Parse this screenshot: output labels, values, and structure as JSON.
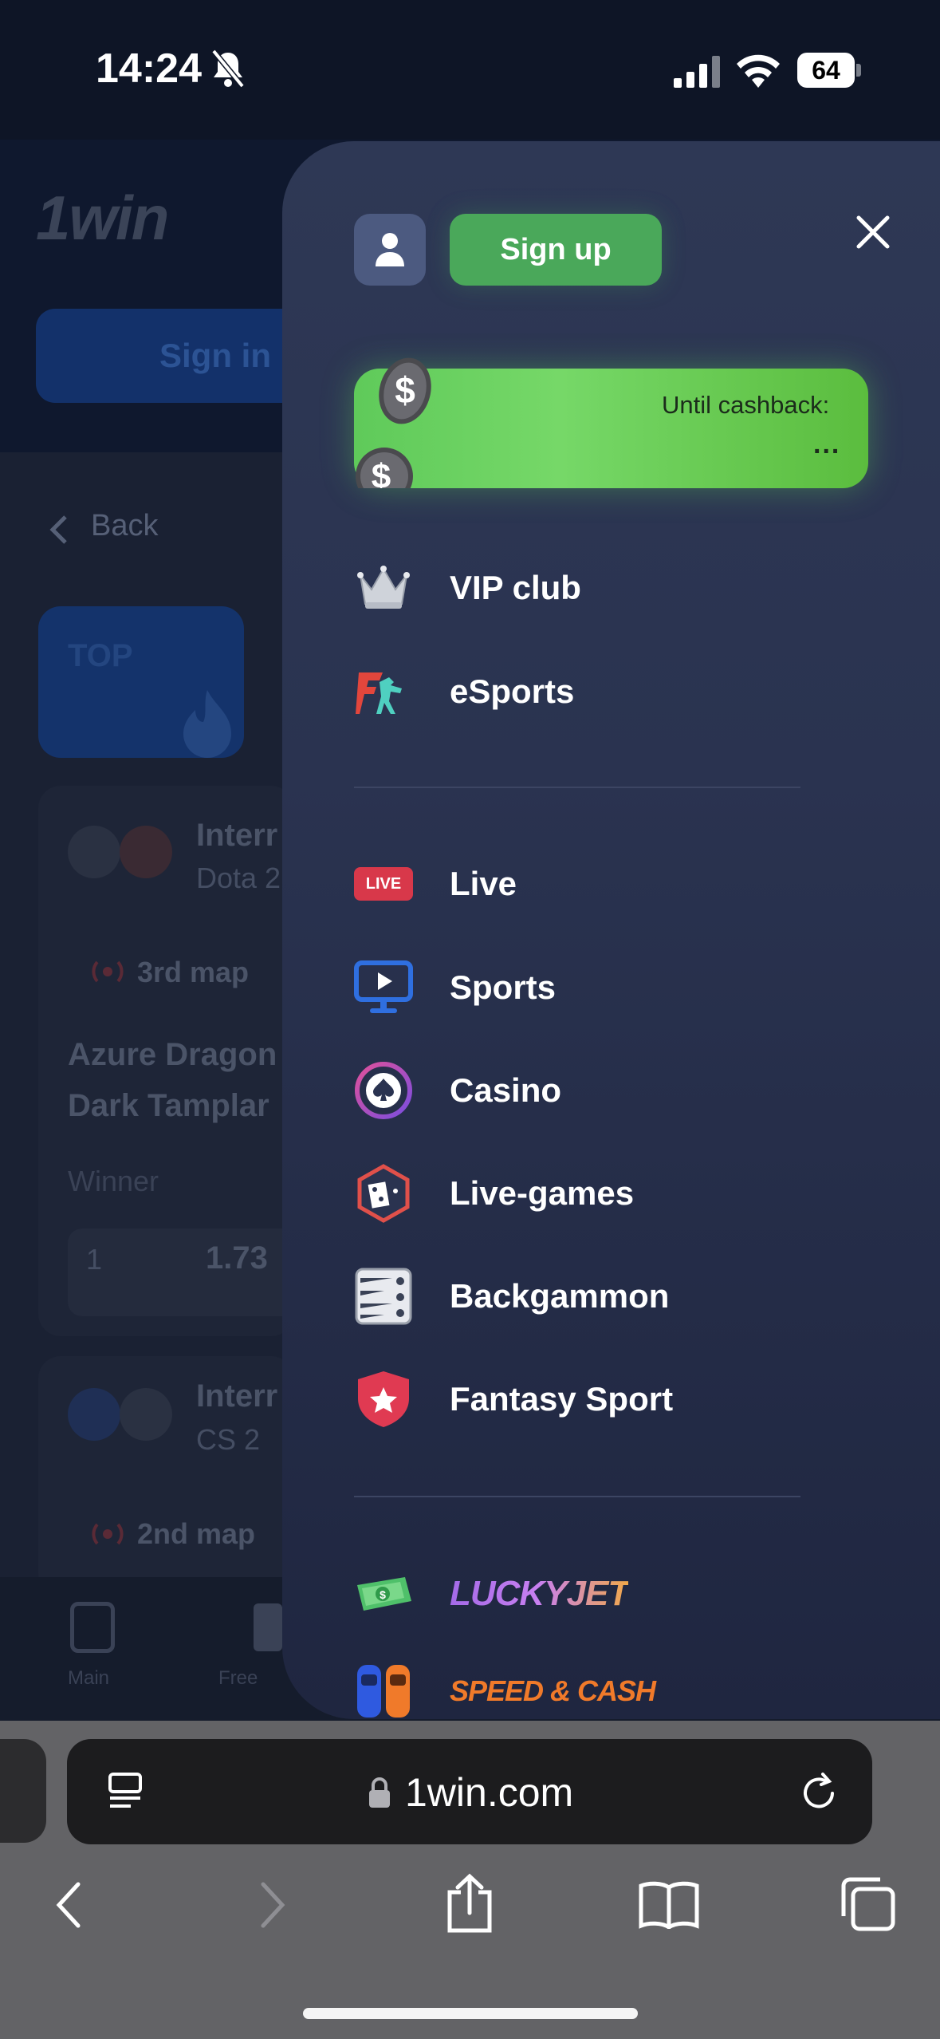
{
  "status_bar": {
    "time": "14:24",
    "battery": "64"
  },
  "background_page": {
    "logo": "1win",
    "sign_in": "Sign in",
    "back": "Back",
    "top_badge": "TOP",
    "card1": {
      "title": "Interr",
      "game": "Dota 2",
      "map": "3rd map",
      "team1": "Azure Dragon",
      "team2": "Dark Tamplar",
      "market": "Winner",
      "outcome": "1",
      "odds": "1.73"
    },
    "card2": {
      "title": "Interr",
      "game": "CS 2",
      "map": "2nd map"
    },
    "tabs": [
      "Main",
      "Free"
    ]
  },
  "menu": {
    "signup": "Sign up",
    "cashback": {
      "label": "Until cashback:",
      "value": "..."
    },
    "section1": [
      {
        "label": "VIP club",
        "icon": "crown-icon"
      },
      {
        "label": "eSports",
        "icon": "esports-icon"
      }
    ],
    "section2": [
      {
        "label": "Live",
        "icon": "live-badge-icon",
        "badge": "LIVE"
      },
      {
        "label": "Sports",
        "icon": "monitor-play-icon"
      },
      {
        "label": "Casino",
        "icon": "spade-chip-icon"
      },
      {
        "label": "Live-games",
        "icon": "dice-icon"
      },
      {
        "label": "Backgammon",
        "icon": "backgammon-icon"
      },
      {
        "label": "Fantasy Sport",
        "icon": "shield-star-icon"
      }
    ],
    "games": [
      {
        "label": "LUCKYJET",
        "icon": "money-icon"
      },
      {
        "label": "SPEED & CASH",
        "icon": "cars-icon"
      }
    ]
  },
  "browser": {
    "url": "1win.com"
  },
  "colors": {
    "signup": "#4aa85a",
    "cashback": "#6ad45e",
    "panel": "#2a3350",
    "live_badge": "#d8384a",
    "sports_icon": "#2f6fe0"
  }
}
